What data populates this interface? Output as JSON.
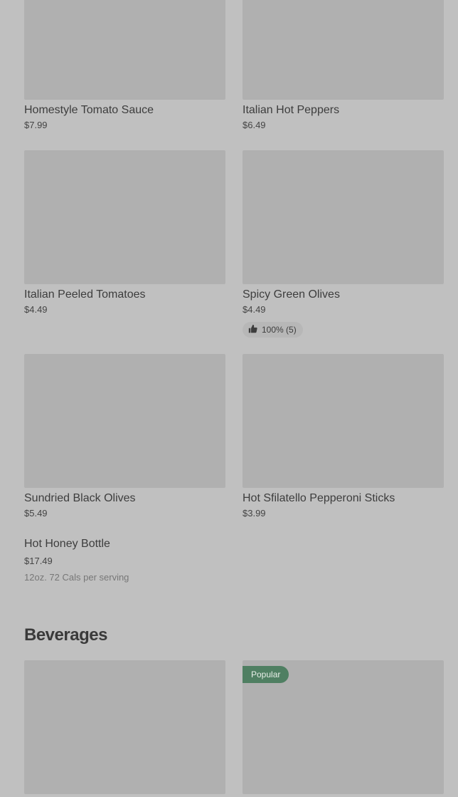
{
  "products": [
    {
      "name": "Homestyle Tomato Sauce",
      "price": "$7.99"
    },
    {
      "name": "Italian Hot Peppers",
      "price": "$6.49"
    },
    {
      "name": "Italian Peeled Tomatoes",
      "price": "$4.49"
    },
    {
      "name": "Spicy Green Olives",
      "price": "$4.49",
      "rating": "100% (5)"
    },
    {
      "name": "Sundried Black Olives",
      "price": "$5.49"
    },
    {
      "name": "Hot Sfilatello Pepperoni Sticks",
      "price": "$3.99"
    },
    {
      "name": "Hot Honey Bottle",
      "price": "$17.49",
      "description": "12oz. 72 Cals per serving"
    }
  ],
  "section": {
    "title": "Beverages"
  },
  "beverages": [
    {
      "badge": ""
    },
    {
      "badge": "Popular"
    }
  ],
  "icons": {
    "rating": "thumbs-up-icon"
  },
  "colors": {
    "background": "#c0c0c0",
    "image_placeholder": "#b0b0b0",
    "badge": "#4f7f62"
  }
}
